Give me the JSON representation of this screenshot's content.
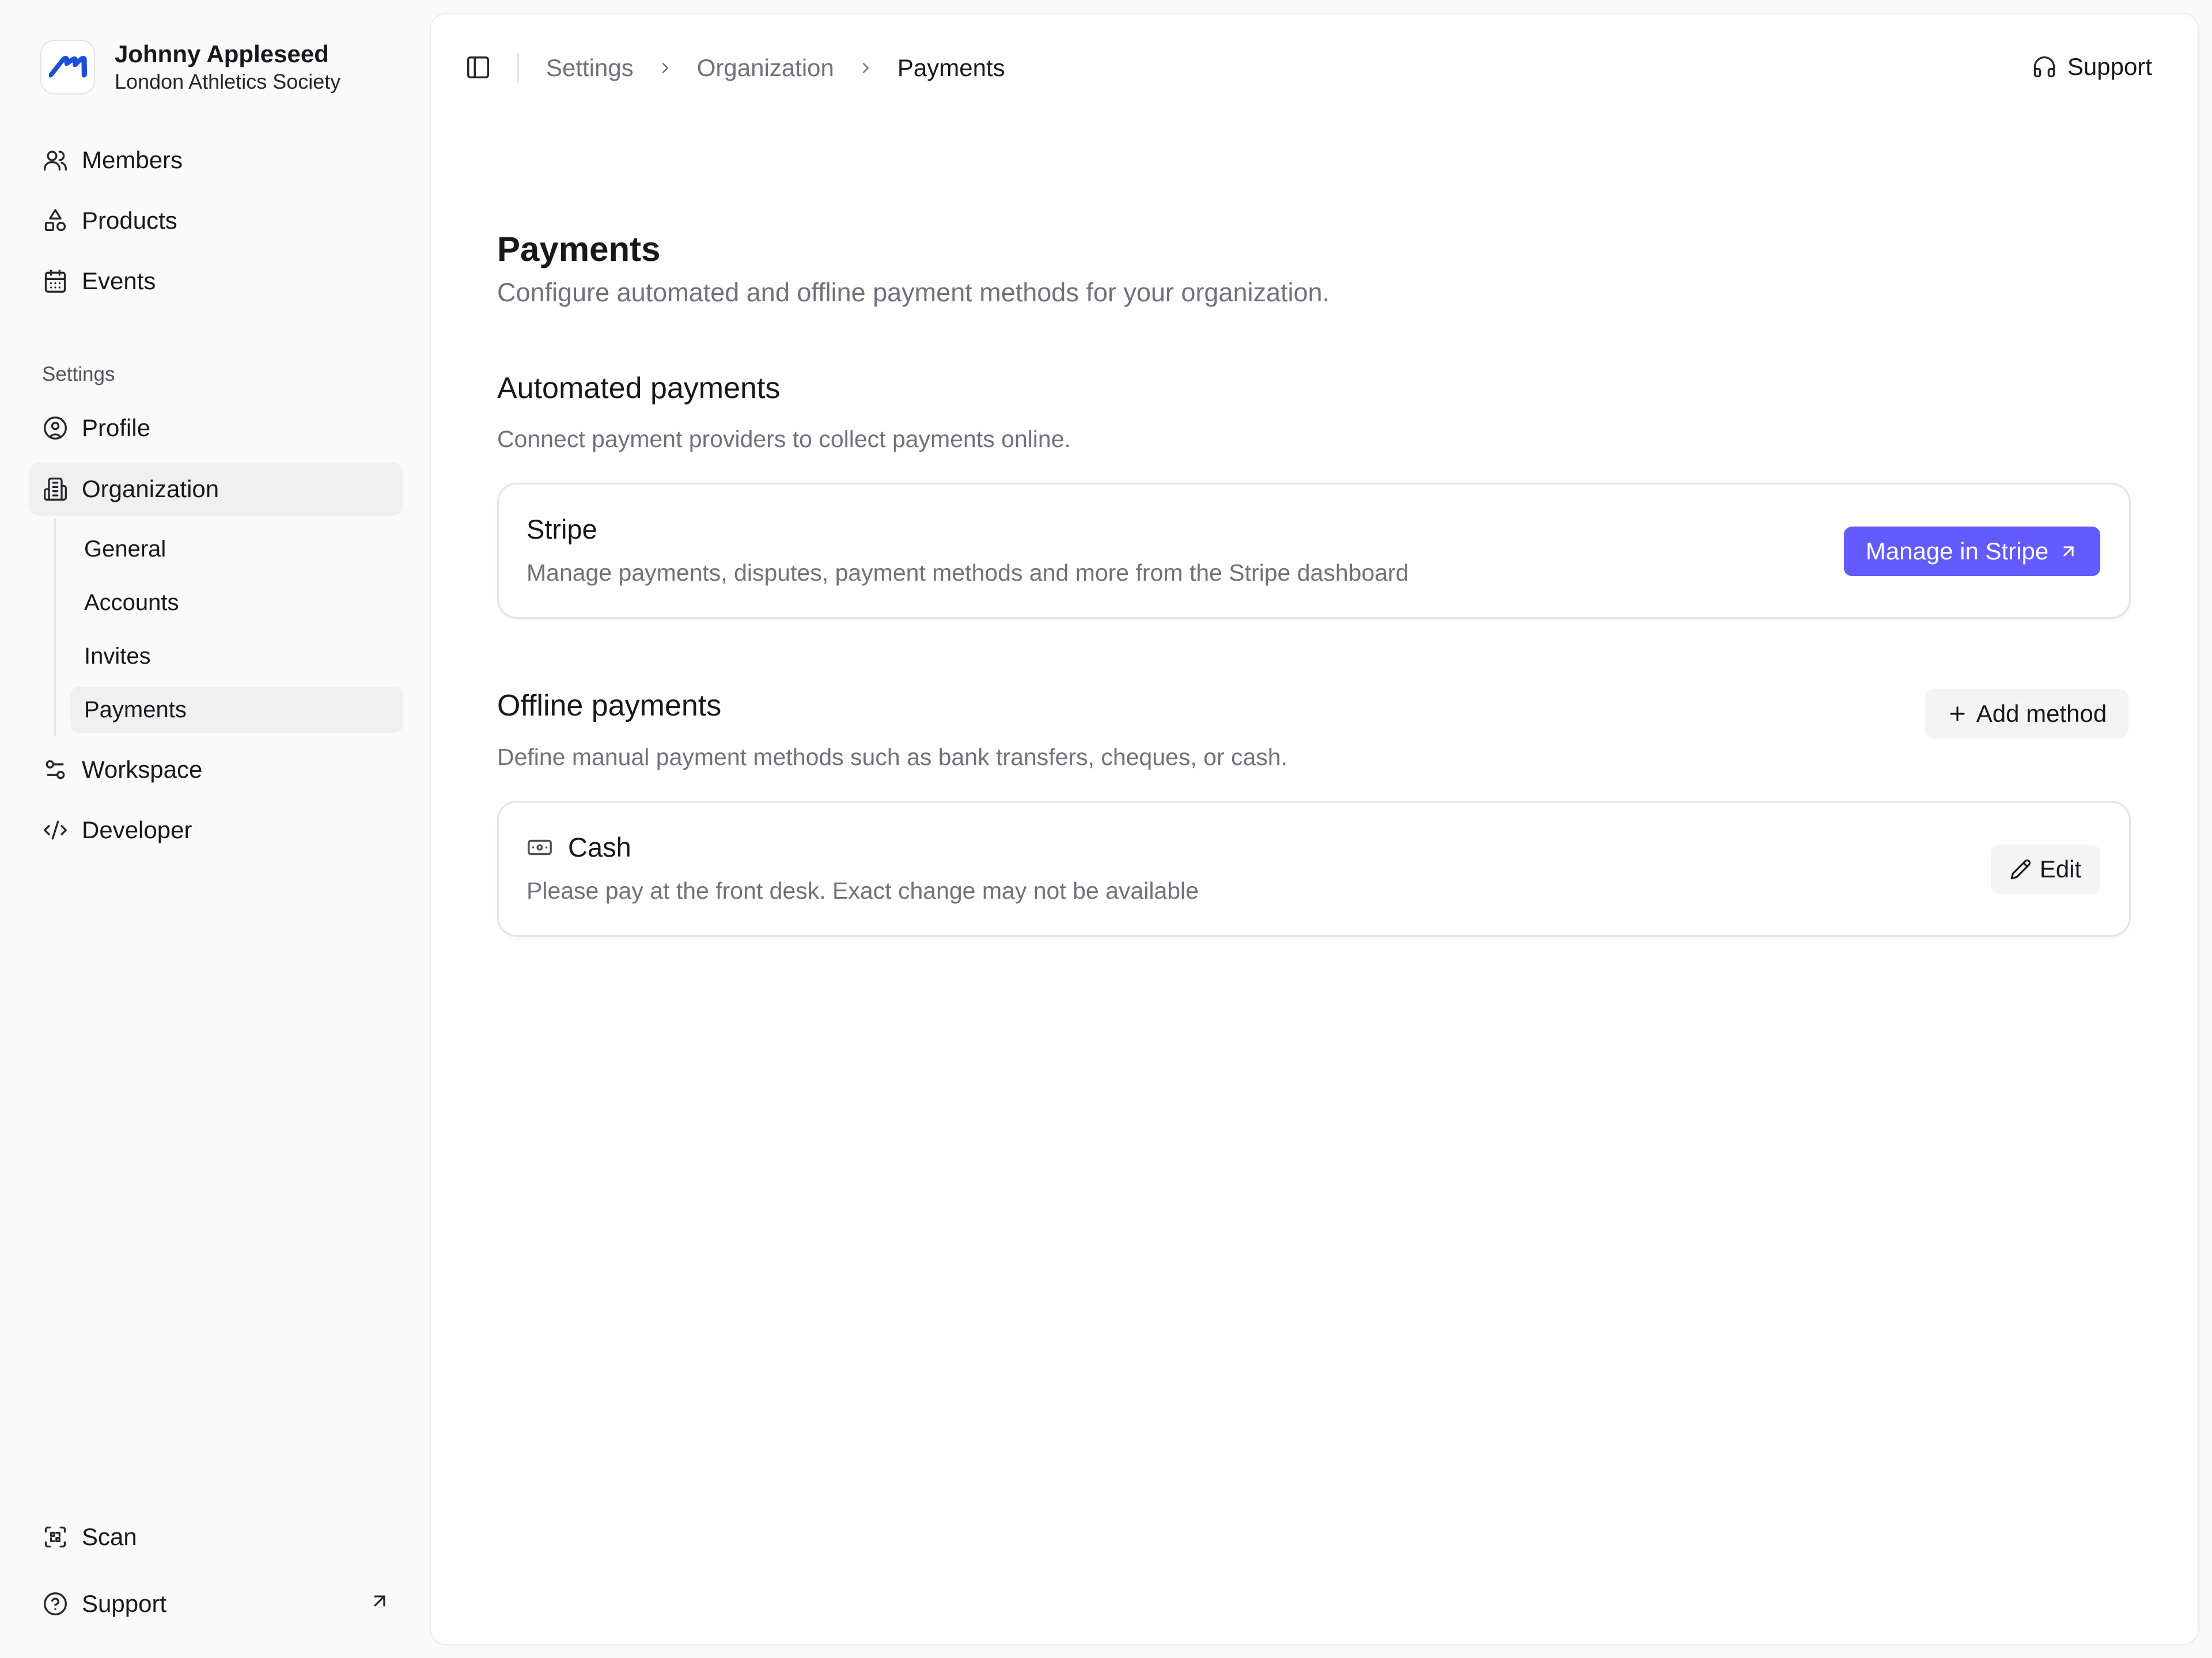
{
  "user": {
    "name": "Johnny Appleseed",
    "organization": "London Athletics Society",
    "logo_icon": "brand-logo-icon"
  },
  "sidebar": {
    "main_items": [
      {
        "label": "Members",
        "icon": "users-icon"
      },
      {
        "label": "Products",
        "icon": "shapes-icon"
      },
      {
        "label": "Events",
        "icon": "calendar-icon"
      }
    ],
    "settings_label": "Settings",
    "settings_items": [
      {
        "label": "Profile",
        "icon": "user-circle-icon"
      },
      {
        "label": "Organization",
        "icon": "building-icon",
        "active": true
      },
      {
        "label": "Workspace",
        "icon": "sliders-icon"
      },
      {
        "label": "Developer",
        "icon": "code-icon"
      }
    ],
    "organization_subitems": [
      {
        "label": "General"
      },
      {
        "label": "Accounts"
      },
      {
        "label": "Invites"
      },
      {
        "label": "Payments",
        "active": true
      }
    ],
    "footer_items": [
      {
        "label": "Scan",
        "icon": "scan-icon"
      },
      {
        "label": "Support",
        "icon": "help-circle-icon",
        "external_icon": "arrow-up-right-icon"
      }
    ]
  },
  "header": {
    "breadcrumb": [
      "Settings",
      "Organization",
      "Payments"
    ],
    "support_label": "Support"
  },
  "page": {
    "title": "Payments",
    "subtitle": "Configure automated and offline payment methods for your organization."
  },
  "automated": {
    "title": "Automated payments",
    "subtitle": "Connect payment providers to collect payments online.",
    "provider": {
      "name": "Stripe",
      "description": "Manage payments, disputes, payment methods and more from the Stripe dashboard",
      "button_label": "Manage in Stripe"
    }
  },
  "offline": {
    "title": "Offline payments",
    "subtitle": "Define manual payment methods such as bank transfers, cheques, or cash.",
    "add_label": "Add method",
    "methods": [
      {
        "name": "Cash",
        "description": "Please pay at the front desk. Exact change may not be available",
        "icon": "banknote-icon",
        "edit_label": "Edit"
      }
    ]
  },
  "colors": {
    "accent": "#635bff",
    "brand": "#1d4ed8",
    "muted_text": "#71717a"
  }
}
